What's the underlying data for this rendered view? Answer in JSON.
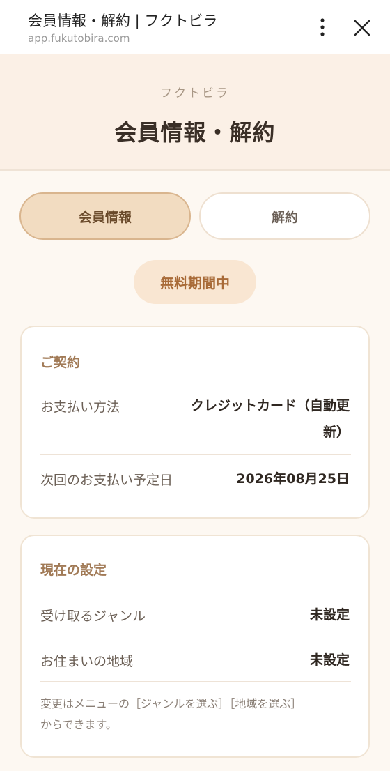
{
  "browser": {
    "title": "会員情報・解約 | フクトビラ",
    "url": "app.fukutobira.com"
  },
  "header": {
    "brand": "フクトビラ",
    "title": "会員情報・解約"
  },
  "tabs": [
    {
      "label": "会員情報",
      "active": true
    },
    {
      "label": "解約",
      "active": false
    }
  ],
  "status_badge": "無料期間中",
  "contract": {
    "heading": "ご契約",
    "rows": [
      {
        "label": "お支払い方法",
        "value_line1": "クレジットカード（自動更",
        "value_line2": "新）"
      },
      {
        "label": "次回のお支払い予定日",
        "value": "2026年08月25日"
      }
    ]
  },
  "settings": {
    "heading": "現在の設定",
    "rows": [
      {
        "label": "受け取るジャンル",
        "value": "未設定"
      },
      {
        "label": "お住まいの地域",
        "value": "未設定"
      }
    ],
    "note_line1": "変更はメニューの［ジャンルを選ぶ］［地域を選ぶ］",
    "note_line2": "からできます。"
  },
  "icons": {
    "menu": "more-vert-icon",
    "close": "close-icon"
  },
  "colors": {
    "background": "#fdf8f2",
    "header_bg": "#fbf0e6",
    "tab_active_bg": "#f2dcc1",
    "accent": "#a86a37",
    "badge_bg": "#f9e6d2"
  }
}
